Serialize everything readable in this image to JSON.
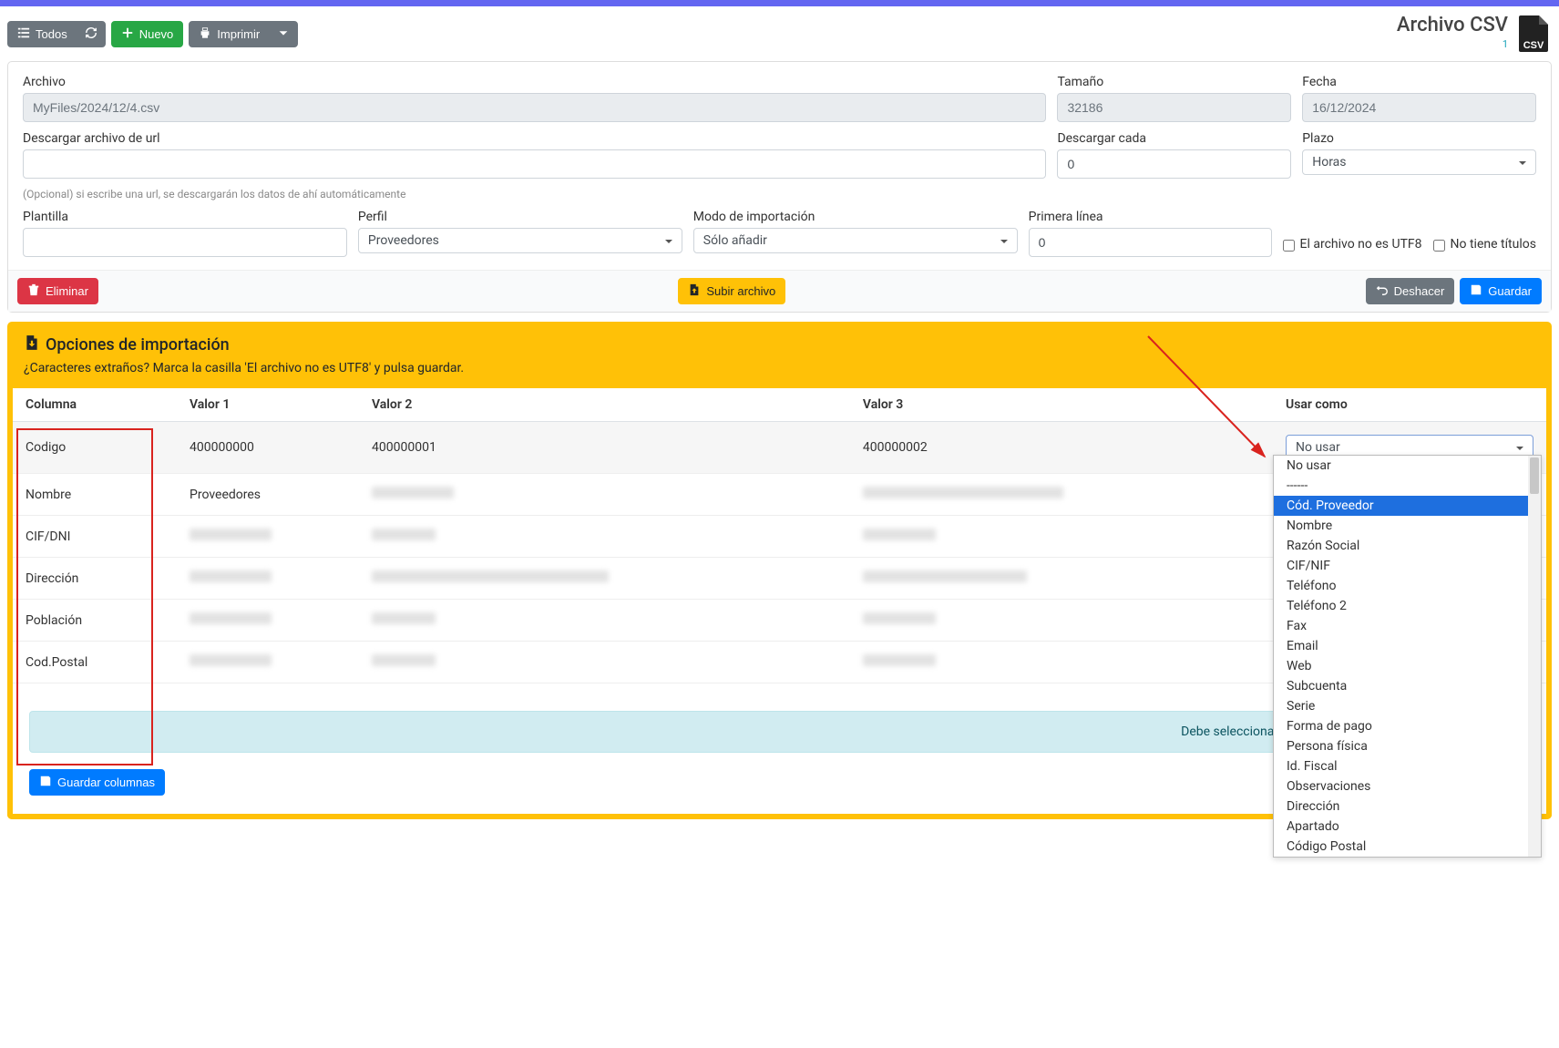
{
  "header": {
    "title": "Archivo CSV",
    "subtitle": "1"
  },
  "toolbar": {
    "todos": "Todos",
    "nuevo": "Nuevo",
    "imprimir": "Imprimir"
  },
  "form": {
    "archivo_label": "Archivo",
    "archivo_value": "MyFiles/2024/12/4.csv",
    "tamano_label": "Tamaño",
    "tamano_value": "32186",
    "fecha_label": "Fecha",
    "fecha_value": "16/12/2024",
    "url_label": "Descargar archivo de url",
    "url_value": "",
    "cada_label": "Descargar cada",
    "cada_value": "0",
    "plazo_label": "Plazo",
    "plazo_value": "Horas",
    "url_help": "(Opcional) si escribe una url, se descargarán los datos de ahí automáticamente",
    "plantilla_label": "Plantilla",
    "plantilla_value": "",
    "perfil_label": "Perfil",
    "perfil_value": "Proveedores",
    "modo_label": "Modo de importación",
    "modo_value": "Sólo añadir",
    "primera_label": "Primera línea",
    "primera_value": "0",
    "check_utf8_label": "El archivo no es UTF8",
    "check_titles_label": "No tiene títulos"
  },
  "footer": {
    "eliminar": "Eliminar",
    "subir": "Subir archivo",
    "deshacer": "Deshacer",
    "guardar": "Guardar"
  },
  "import": {
    "heading": "Opciones de importación",
    "hint": "¿Caracteres extraños? Marca la casilla 'El archivo no es UTF8' y pulsa guardar.",
    "cols": {
      "c1": "Columna",
      "c2": "Valor 1",
      "c3": "Valor 2",
      "c4": "Valor 3",
      "c5": "Usar como"
    },
    "dropdown_selected": "No usar",
    "dropdown_options": [
      "No usar",
      "------",
      "Cód. Proveedor",
      "Nombre",
      "Razón Social",
      "CIF/NIF",
      "Teléfono",
      "Teléfono 2",
      "Fax",
      "Email",
      "Web",
      "Subcuenta",
      "Serie",
      "Forma de pago",
      "Persona física",
      "Id. Fiscal",
      "Observaciones",
      "Dirección",
      "Apartado",
      "Código Postal"
    ],
    "dropdown_highlighted_index": 2,
    "rows": [
      {
        "col": "Codigo",
        "v1": "400000000",
        "v2": "400000001",
        "v3": "400000002"
      },
      {
        "col": "Nombre",
        "v1": "Proveedores",
        "v2": "",
        "v3": ""
      },
      {
        "col": "CIF/DNI",
        "v1": "",
        "v2": "",
        "v3": ""
      },
      {
        "col": "Dirección",
        "v1": "",
        "v2": "",
        "v3": ""
      },
      {
        "col": "Población",
        "v1": "",
        "v2": "",
        "v3": ""
      },
      {
        "col": "Cod.Postal",
        "v1": "",
        "v2": "",
        "v3": ""
      }
    ],
    "alert": "Debe seleccionar uno de los siguientes campos requeridos",
    "guardar_cols": "Guardar columnas"
  }
}
